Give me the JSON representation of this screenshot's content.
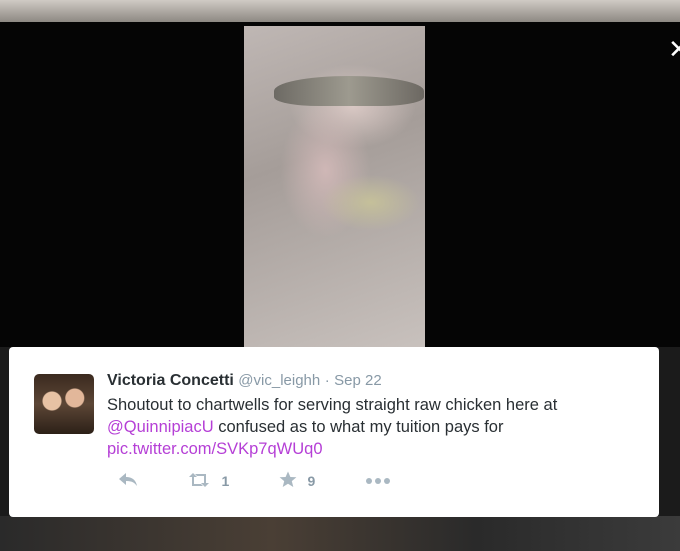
{
  "tweet": {
    "display_name": "Victoria Concetti",
    "handle": "@vic_leighh",
    "separator": "·",
    "date": "Sep 22",
    "text_before": "Shoutout to chartwells for serving straight raw chicken here at ",
    "mention": "@QuinnipiacU",
    "text_after": " confused as to what my tuition pays for",
    "link": "pic.twitter.com/SVKp7qWUq0",
    "retweet_count": "1",
    "favorite_count": "9"
  },
  "modal": {
    "close_glyph": "✕"
  },
  "icons": {
    "reply": "reply-icon",
    "retweet": "retweet-icon",
    "favorite": "star-icon",
    "more": "more-icon"
  }
}
